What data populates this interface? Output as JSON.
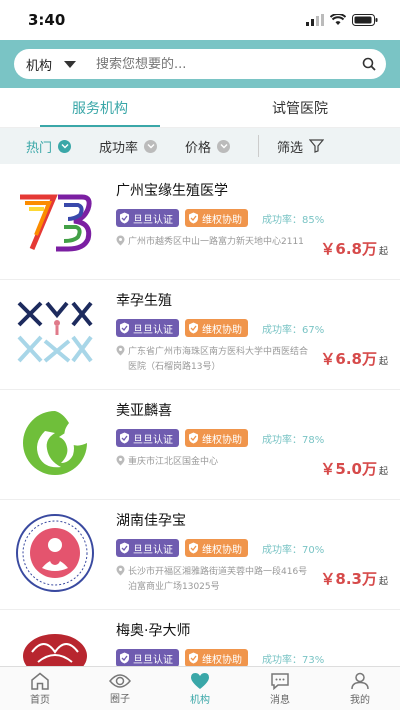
{
  "status": {
    "time": "3:40"
  },
  "search": {
    "type": "机构",
    "placeholder": "搜索您想要的..."
  },
  "tabs": [
    {
      "label": "服务机构",
      "active": true
    },
    {
      "label": "试管医院",
      "active": false
    }
  ],
  "filters": {
    "hot": "热门",
    "success": "成功率",
    "price": "价格",
    "screen": "筛选"
  },
  "badges": {
    "verify": "旦旦认证",
    "rights": "维权协助"
  },
  "price_suffix": "起",
  "items": [
    {
      "name": "广州宝缘生殖医学",
      "rate": "成功率：85%",
      "address": "广州市越秀区中山一路富力新天地中心2111",
      "price": "￥6.8万",
      "logo": "yb-rainbow-logo"
    },
    {
      "name": "幸孕生殖",
      "rate": "成功率：67%",
      "address": "广东省广州市海珠区南方医科大学中西医结合医院（石榴岗路13号）",
      "price": "￥6.8万",
      "logo": "xy-cross-logo"
    },
    {
      "name": "美亚麟喜",
      "rate": "成功率：78%",
      "address": "重庆市江北区国金中心",
      "price": "￥5.0万",
      "logo": "green-swirl-logo"
    },
    {
      "name": "湖南佳孕宝",
      "rate": "成功率：70%",
      "address": "长沙市开福区湘雅路街道芙蓉中路一段416号泊富商业广场13025号",
      "price": "￥8.3万",
      "logo": "pink-seal-logo"
    },
    {
      "name": "梅奥·孕大师",
      "rate": "成功率：73%",
      "address": "",
      "price": "",
      "logo": "red-flower-logo"
    }
  ],
  "tabbar": [
    {
      "label": "首页",
      "icon": "home-icon",
      "active": false
    },
    {
      "label": "圈子",
      "icon": "eye-icon",
      "active": false
    },
    {
      "label": "机构",
      "icon": "heart-icon",
      "active": true
    },
    {
      "label": "消息",
      "icon": "chat-icon",
      "active": false
    },
    {
      "label": "我的",
      "icon": "user-icon",
      "active": false
    }
  ],
  "colors": {
    "accent": "#3aa7a8",
    "searchband": "#7ac4c5",
    "badge_purple": "#6f5cb0",
    "badge_orange": "#f0954c",
    "price": "#d64a4a"
  }
}
